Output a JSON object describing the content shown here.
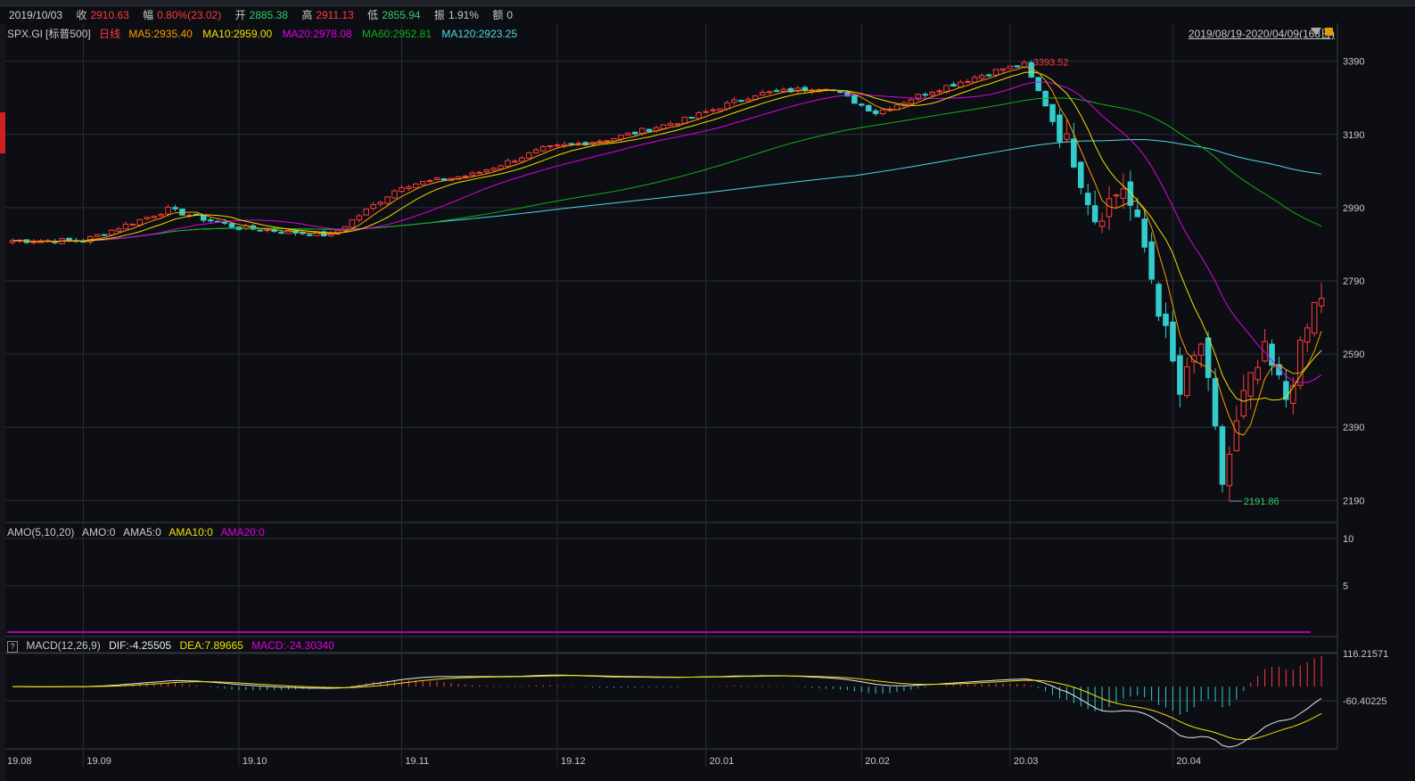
{
  "info": {
    "date": "2019/10/03",
    "close_label": "收",
    "close": "2910.63",
    "change_label": "幅",
    "change": "0.80%(23.02)",
    "open_label": "开",
    "open": "2885.38",
    "high_label": "高",
    "high": "2911.13",
    "low_label": "低",
    "low": "2855.94",
    "amp_label": "振",
    "amp": "1.91%",
    "amount_label": "额",
    "amount": "0"
  },
  "symbol": "SPX.GI",
  "symbol_name": "[标普500]",
  "period": "日线",
  "ma": {
    "ma5": "MA5:2935.40",
    "ma10": "MA10:2959.00",
    "ma20": "MA20:2978.08",
    "ma60": "MA60:2952.81",
    "ma120": "MA120:2923.25"
  },
  "range": "2019/08/19-2020/04/09(163日)",
  "amo": {
    "label": "AMO(5,10,20)",
    "amo": "AMO:0",
    "ama5": "AMA5:0",
    "ama10": "AMA10:0",
    "ama20": "AMA20:0"
  },
  "macd": {
    "help": "?",
    "label": "MACD(12,26,9)",
    "dif": "DIF:-4.25505",
    "dea": "DEA:7.89665",
    "macd": "MACD:-24.30340"
  },
  "colors": {
    "up": "#ff3b3b",
    "down": "#33cccc",
    "ma5": "#ff9c00",
    "ma10": "#f0e000",
    "ma20": "#e000e0",
    "ma60": "#10b010",
    "ma120": "#50d8e0",
    "dif": "#e8e8e8",
    "dea": "#f0e000",
    "amo": "#e000e0",
    "grid": "#2a2d34"
  },
  "chart_data": {
    "type": "candlestick",
    "price_ticks": [
      "3390",
      "3190",
      "2990",
      "2790",
      "2590",
      "2390",
      "2190"
    ],
    "amo_ticks": [
      "10",
      "5"
    ],
    "macd_ticks": [
      "116.21571",
      "-60.40225"
    ],
    "x_ticks": [
      "19.08",
      "19.09",
      "19.10",
      "19.11",
      "19.12",
      "20.01",
      "20.02",
      "20.03",
      "20.04"
    ],
    "ylim": [
      2130,
      3450
    ],
    "high_annotation": "3393.52",
    "low_annotation": "2191.86",
    "close_anchors": [
      [
        0,
        2900
      ],
      [
        10,
        2900
      ],
      [
        22,
        2985
      ],
      [
        32,
        2935
      ],
      [
        45,
        2915
      ],
      [
        55,
        3050
      ],
      [
        65,
        3080
      ],
      [
        75,
        3150
      ],
      [
        85,
        3180
      ],
      [
        95,
        3230
      ],
      [
        105,
        3300
      ],
      [
        115,
        3320
      ],
      [
        122,
        3250
      ],
      [
        130,
        3310
      ],
      [
        140,
        3370
      ],
      [
        143,
        3380
      ],
      [
        147,
        3235
      ],
      [
        150,
        3130
      ],
      [
        153,
        2965
      ],
      [
        157,
        3050
      ],
      [
        160,
        2880
      ],
      [
        165,
        2480
      ],
      [
        168,
        2620
      ],
      [
        171,
        2240
      ],
      [
        174,
        2470
      ],
      [
        177,
        2590
      ],
      [
        180,
        2470
      ],
      [
        184,
        2720
      ],
      [
        186,
        2780
      ]
    ],
    "candle_count": 186
  }
}
